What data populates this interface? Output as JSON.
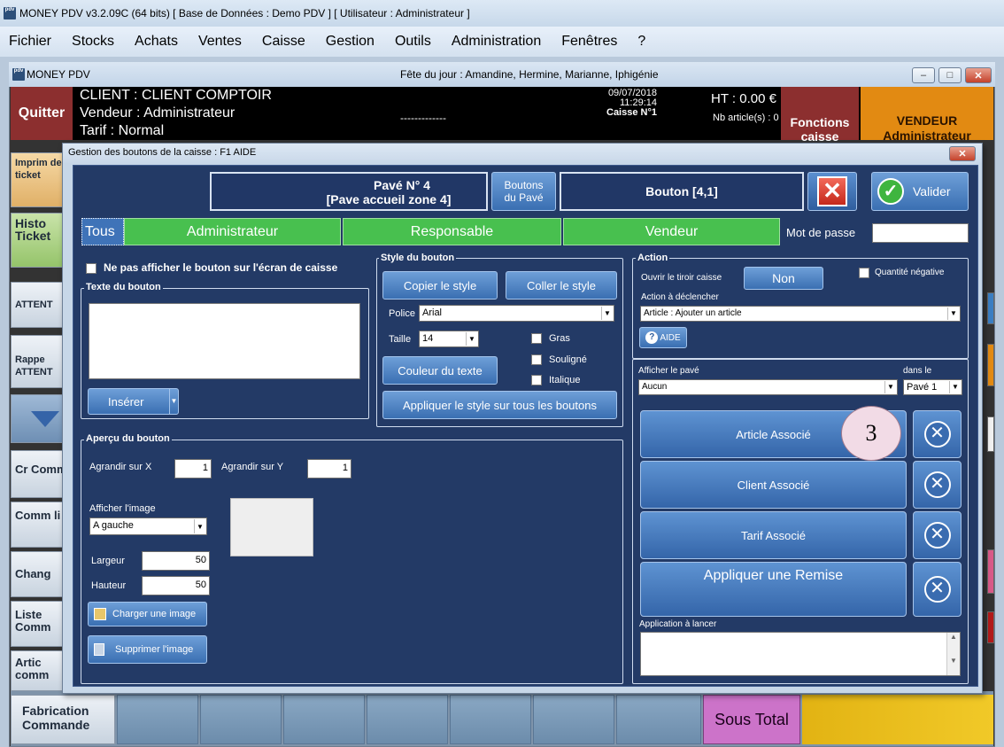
{
  "app": {
    "window_title": "MONEY PDV v3.2.09C (64 bits) [ Base de Données : Demo PDV ] [ Utilisateur : Administrateur ]",
    "icon_text": "money pdv"
  },
  "menu": [
    "Fichier",
    "Stocks",
    "Achats",
    "Ventes",
    "Caisse",
    "Gestion",
    "Outils",
    "Administration",
    "Fenêtres",
    "?"
  ],
  "main_window": {
    "title": "MONEY PDV",
    "fete": "Fête du jour : Amandine, Hermine, Marianne, Iphigénie"
  },
  "pos": {
    "quit": "Quitter",
    "client": "CLIENT : CLIENT COMPTOIR",
    "vendeur": "Vendeur : Administrateur",
    "tarif": "Tarif : Normal",
    "dashes": "-------------",
    "datetime": "09/07/2018 11:29:14",
    "caisse": "Caisse N°1",
    "ht": "HT : 0.00 €",
    "nb_articles": "Nb article(s) : 0",
    "fonctions": "Fonctions caisse",
    "vendeur_btn_1": "VENDEUR",
    "vendeur_btn_2": "Administrateur"
  },
  "left_buttons": [
    {
      "label": "Imprim derni ticket"
    },
    {
      "label": "Histo Ticket"
    },
    {
      "label": "ATTENT"
    },
    {
      "label": "Rappe ATTENT"
    },
    {
      "label": "Cr Comm"
    },
    {
      "label": "Comm li"
    },
    {
      "label": "Chang"
    },
    {
      "label": "Liste Comm"
    },
    {
      "label": "Artic comm"
    }
  ],
  "bottom": {
    "fabrication_1": "Fabrication",
    "fabrication_2": "Commande",
    "sous_total": "Sous Total"
  },
  "dialog": {
    "title": "Gestion des boutons de la caisse : F1 AIDE",
    "pave_line1": "Pavé N° 4",
    "pave_line2": "[Pave accueil zone 4]",
    "boutons_line1": "Boutons",
    "boutons_line2": "du Pavé",
    "bouton": "Bouton [4,1]",
    "valider": "Valider",
    "tabs": {
      "tous": "Tous",
      "admin": "Administrateur",
      "resp": "Responsable",
      "vendeur": "Vendeur"
    },
    "mot_de_passe": "Mot de passe",
    "ne_pas_afficher": "Ne pas afficher le bouton sur l'écran de caisse",
    "texte_du_bouton": "Texte du bouton",
    "inserer": "Insérer",
    "style": {
      "legend": "Style du bouton",
      "copier": "Copier le style",
      "coller": "Coller le style",
      "police_label": "Police",
      "police_value": "Arial",
      "taille_label": "Taille",
      "taille_value": "14",
      "gras": "Gras",
      "souligne": "Souligné",
      "italique": "Italique",
      "couleur": "Couleur du texte",
      "appliquer": "Appliquer le style sur tous les boutons"
    },
    "action": {
      "legend": "Action",
      "tiroir": "Ouvrir le tiroir caisse",
      "non": "Non",
      "quantite": "Quantité négative",
      "declencher": "Action à déclencher",
      "declencher_value": "Article : Ajouter un article",
      "aide": "AIDE",
      "afficher_pave": "Afficher le pavé",
      "dans_le": "dans le",
      "pave_value": "Aucun",
      "pave_num": "Pavé 1"
    },
    "assoc": {
      "article": "Article Associé",
      "client": "Client Associé",
      "tarif": "Tarif Associé",
      "remise": "Appliquer une Remise",
      "badge": "3",
      "application": "Application à lancer"
    },
    "apercu": {
      "legend": "Aperçu du bouton",
      "agrandir_x": "Agrandir sur X",
      "x_value": "1",
      "agrandir_y": "Agrandir sur Y",
      "y_value": "1",
      "afficher_image": "Afficher l'image",
      "image_pos": "A gauche",
      "largeur": "Largeur",
      "largeur_value": "50",
      "hauteur": "Hauteur",
      "hauteur_value": "50",
      "charger": "Charger une image",
      "supprimer": "Supprimer l'image"
    }
  }
}
